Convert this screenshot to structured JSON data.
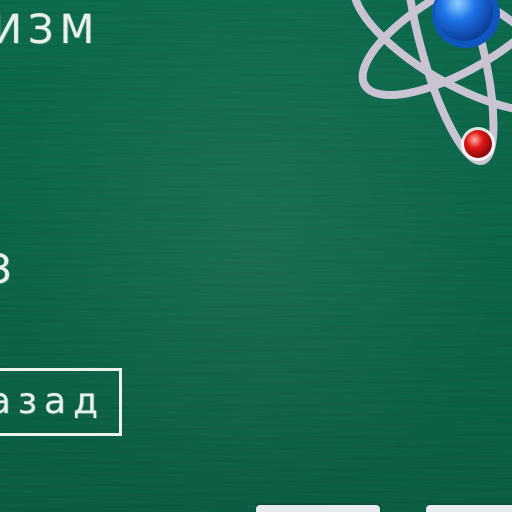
{
  "screen": {
    "title_fragment": "ИЗМ",
    "option_fragment": "З",
    "back_button_label": "назад"
  },
  "decor": {
    "board_color": "#0b6447",
    "atom_orbit_color": "#c9c3d4",
    "nucleus_color": "#1e73e8",
    "electron_color": "#e21818",
    "chalk_color": "#e9efeb"
  },
  "icons": {
    "atom": "atom-icon"
  }
}
